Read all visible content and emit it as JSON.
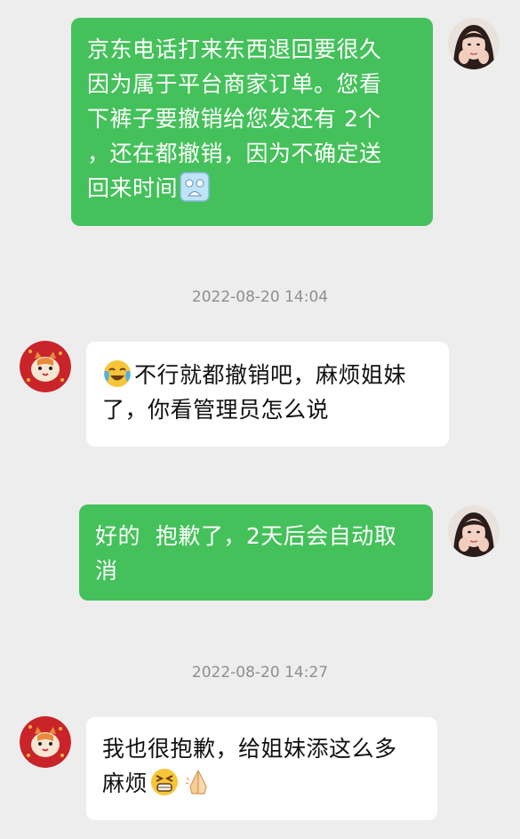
{
  "messages": [
    {
      "id": "m1",
      "direction": "out",
      "lines": [
        "京东电话打来东西退回要很久",
        "因为属于平台商家订单。您看",
        "下裤子要撤销给您发还有 2个",
        "，还在都撤销，因为不确定送",
        "回来时间"
      ],
      "trailing_emoji": "pleading-emoji"
    },
    {
      "id": "m2",
      "direction": "in",
      "leading_emoji": "crying-laughing-emoji",
      "lines": [
        "不行就都撤销吧，麻烦姐妹",
        "了，你看管理员怎么说"
      ]
    },
    {
      "id": "m3",
      "direction": "out",
      "lines": [
        "好的  抱歉了，2天后会自动取",
        "消"
      ]
    },
    {
      "id": "m4",
      "direction": "in",
      "lines": [
        "我也很抱歉，给姐妹添这么多",
        "麻烦"
      ],
      "trailing_emojis": [
        "grinning-squint-emoji",
        "praying-hands-emoji"
      ]
    }
  ],
  "timestamps": [
    "2022-08-20 14:04",
    "2022-08-20 14:27"
  ],
  "colors": {
    "background": "#ededed",
    "outgoing_bubble": "#44c15a",
    "incoming_bubble": "#ffffff",
    "timestamp": "#8f8f8f"
  }
}
